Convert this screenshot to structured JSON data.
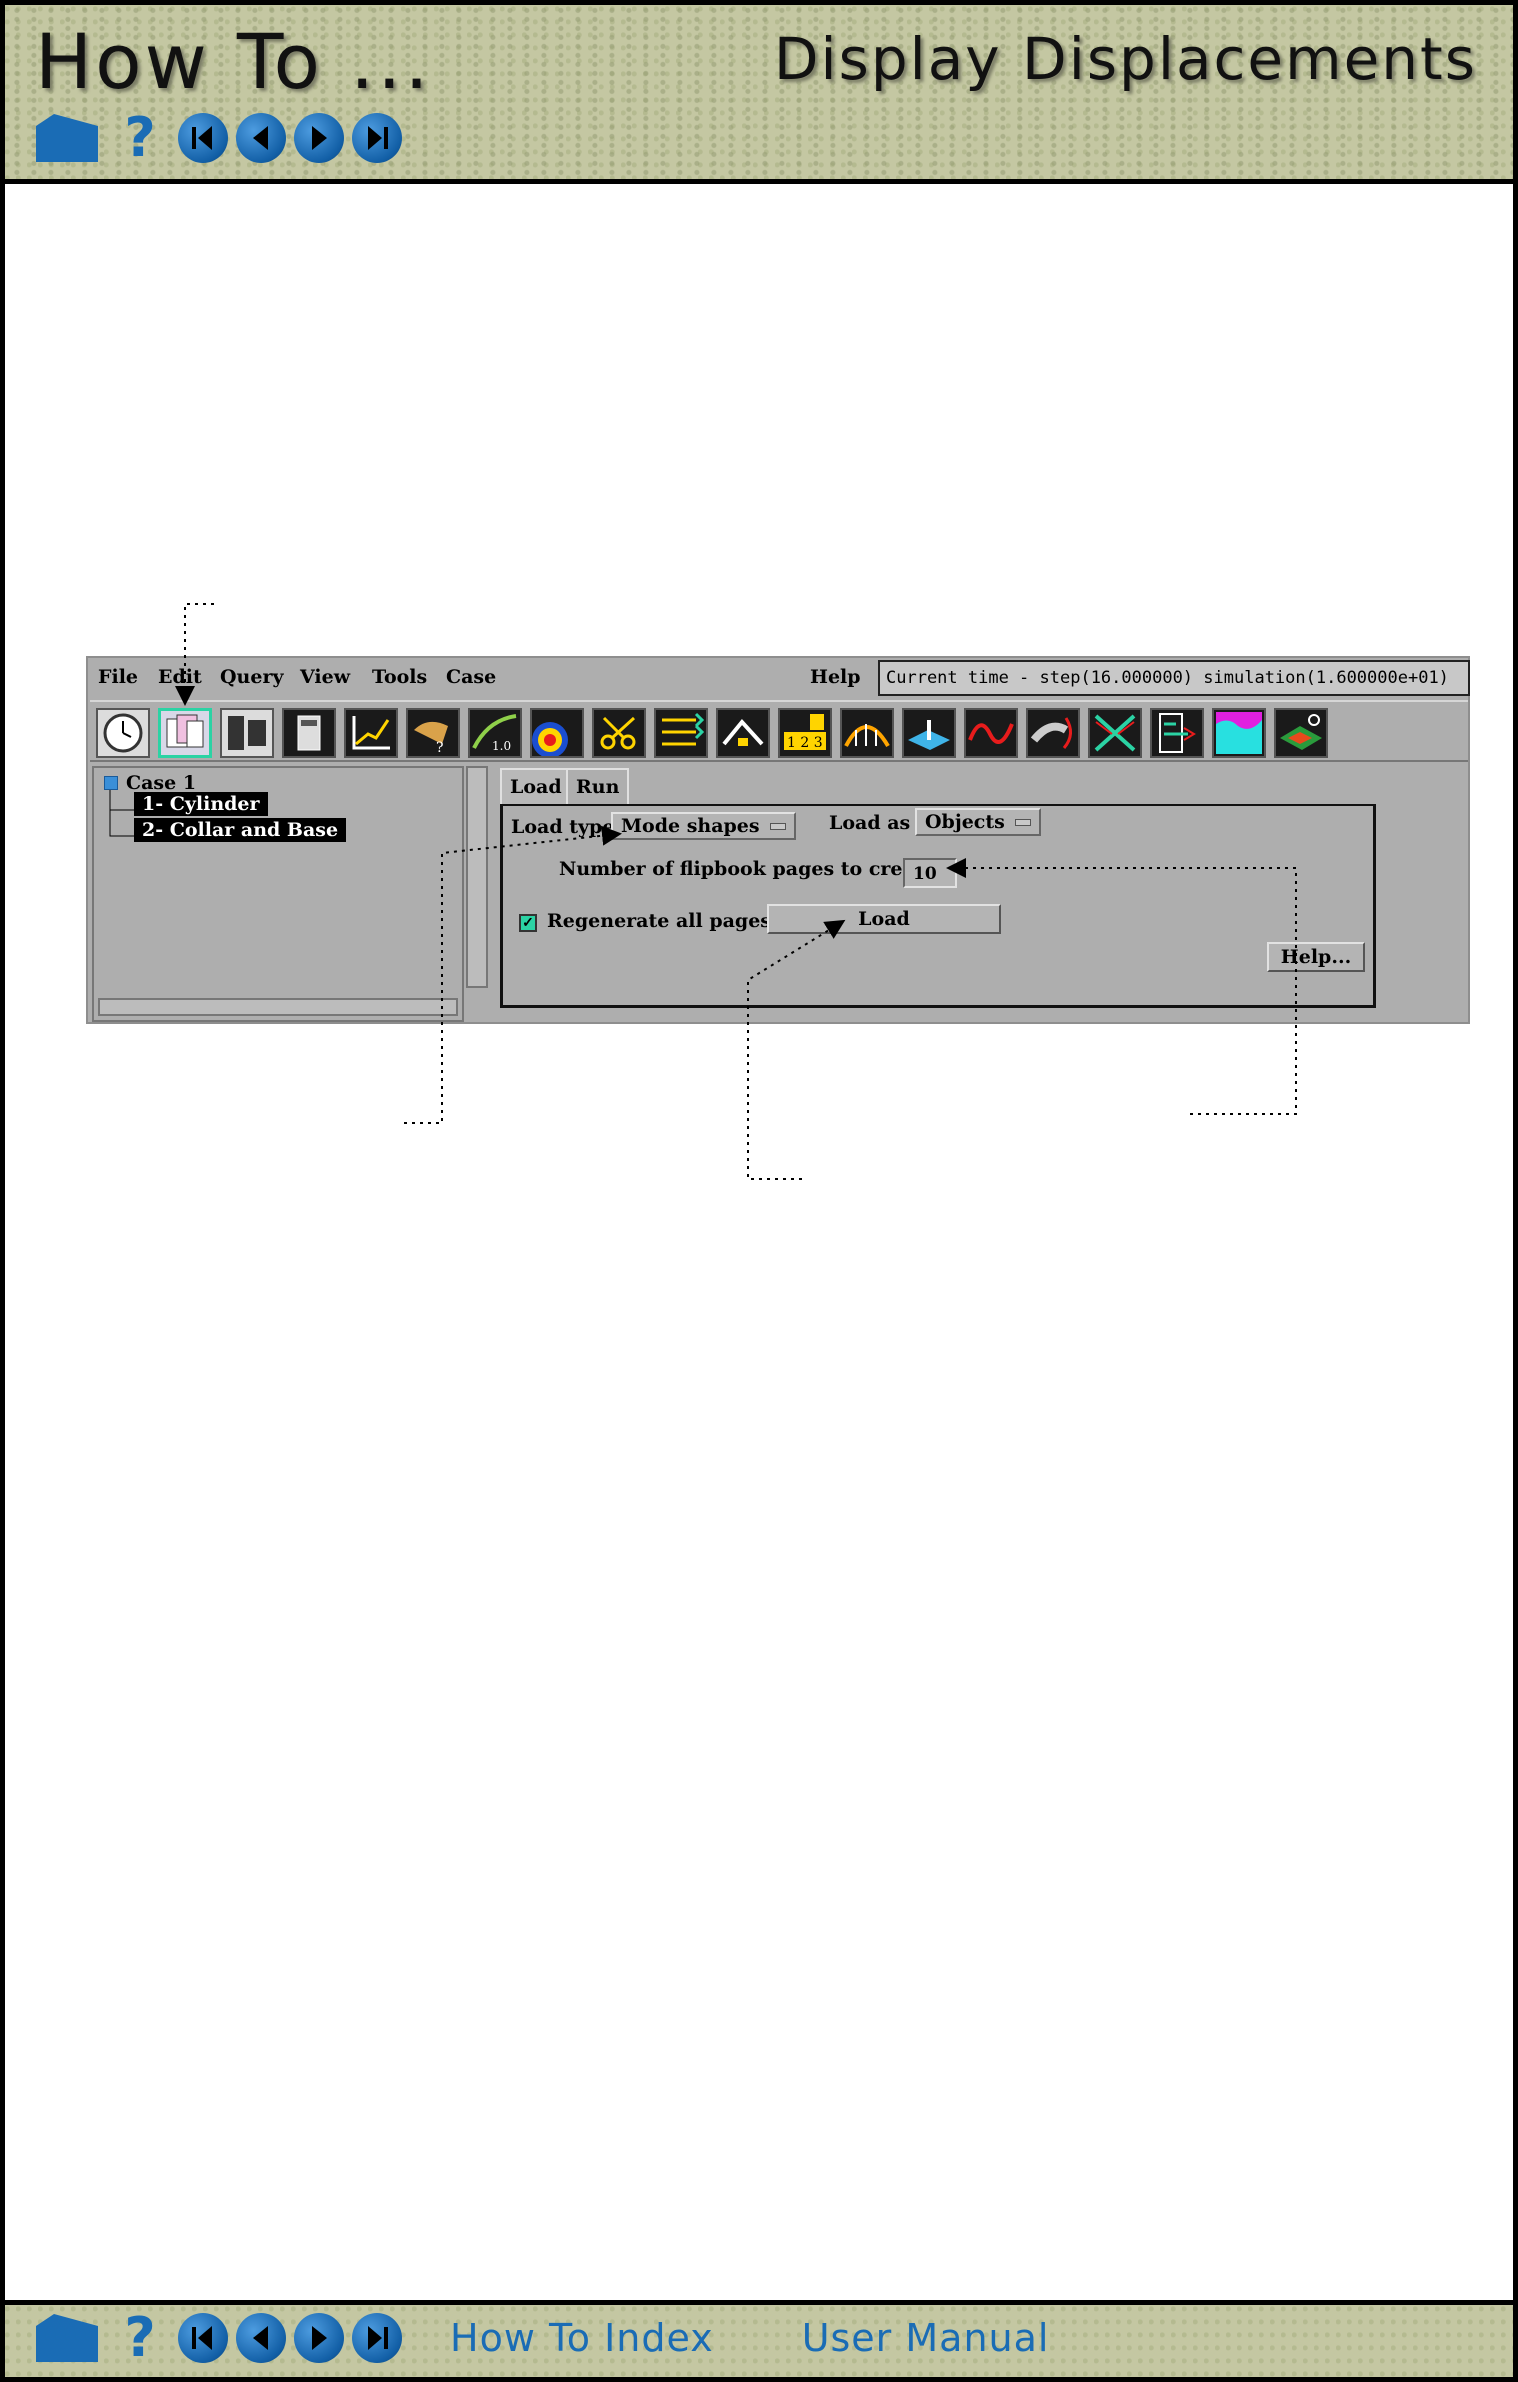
{
  "header": {
    "title": "How To ...",
    "subtitle": "Display Displacements"
  },
  "nav": {
    "home_icon": "home-icon",
    "help_label": "?",
    "buttons": [
      "first-page-icon",
      "previous-page-icon",
      "next-page-icon",
      "last-page-icon"
    ]
  },
  "footer": {
    "howto_index": "How To Index",
    "user_manual": "User Manual"
  },
  "app": {
    "menus": {
      "file": "File",
      "edit": "Edit",
      "query": "Query",
      "view": "View",
      "tools": "Tools",
      "case": "Case",
      "help": "Help"
    },
    "status_text": "Current time - step(16.000000) simulation(1.600000e+01)",
    "tree": {
      "case_label": "Case 1",
      "parts": [
        "1- Cylinder",
        "2- Collar and Base"
      ]
    },
    "tabs": [
      "Load",
      "Run"
    ],
    "load_type_label": "Load type",
    "load_type_value": "Mode shapes",
    "load_as_label": "Load as",
    "load_as_value": "Objects",
    "pages_label": "Number of flipbook pages to create",
    "pages_value": "10",
    "regenerate_label": "Regenerate all pages",
    "regenerate_checked": true,
    "load_button": "Load",
    "help_button": "Help..."
  },
  "colors": {
    "banner": "#c4c7a2",
    "nav_blue": "#1a6cb5",
    "panel_gray": "#aeaeae",
    "active_tool": "#2bd3a4"
  }
}
